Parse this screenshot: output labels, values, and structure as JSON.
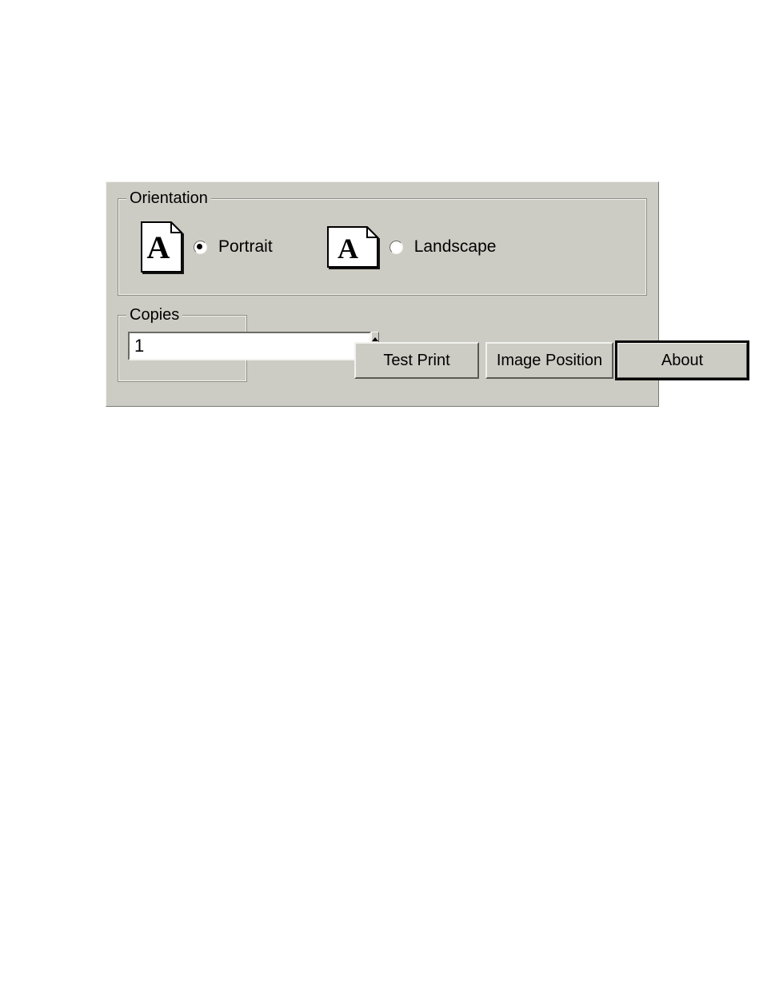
{
  "orientation": {
    "legend": "Orientation",
    "portrait_label": "Portrait",
    "landscape_label": "Landscape",
    "selected": "portrait"
  },
  "copies": {
    "legend": "Copies",
    "value": "1"
  },
  "buttons": {
    "test_print": "Test Print",
    "image_position": "Image Position",
    "about": "About"
  }
}
